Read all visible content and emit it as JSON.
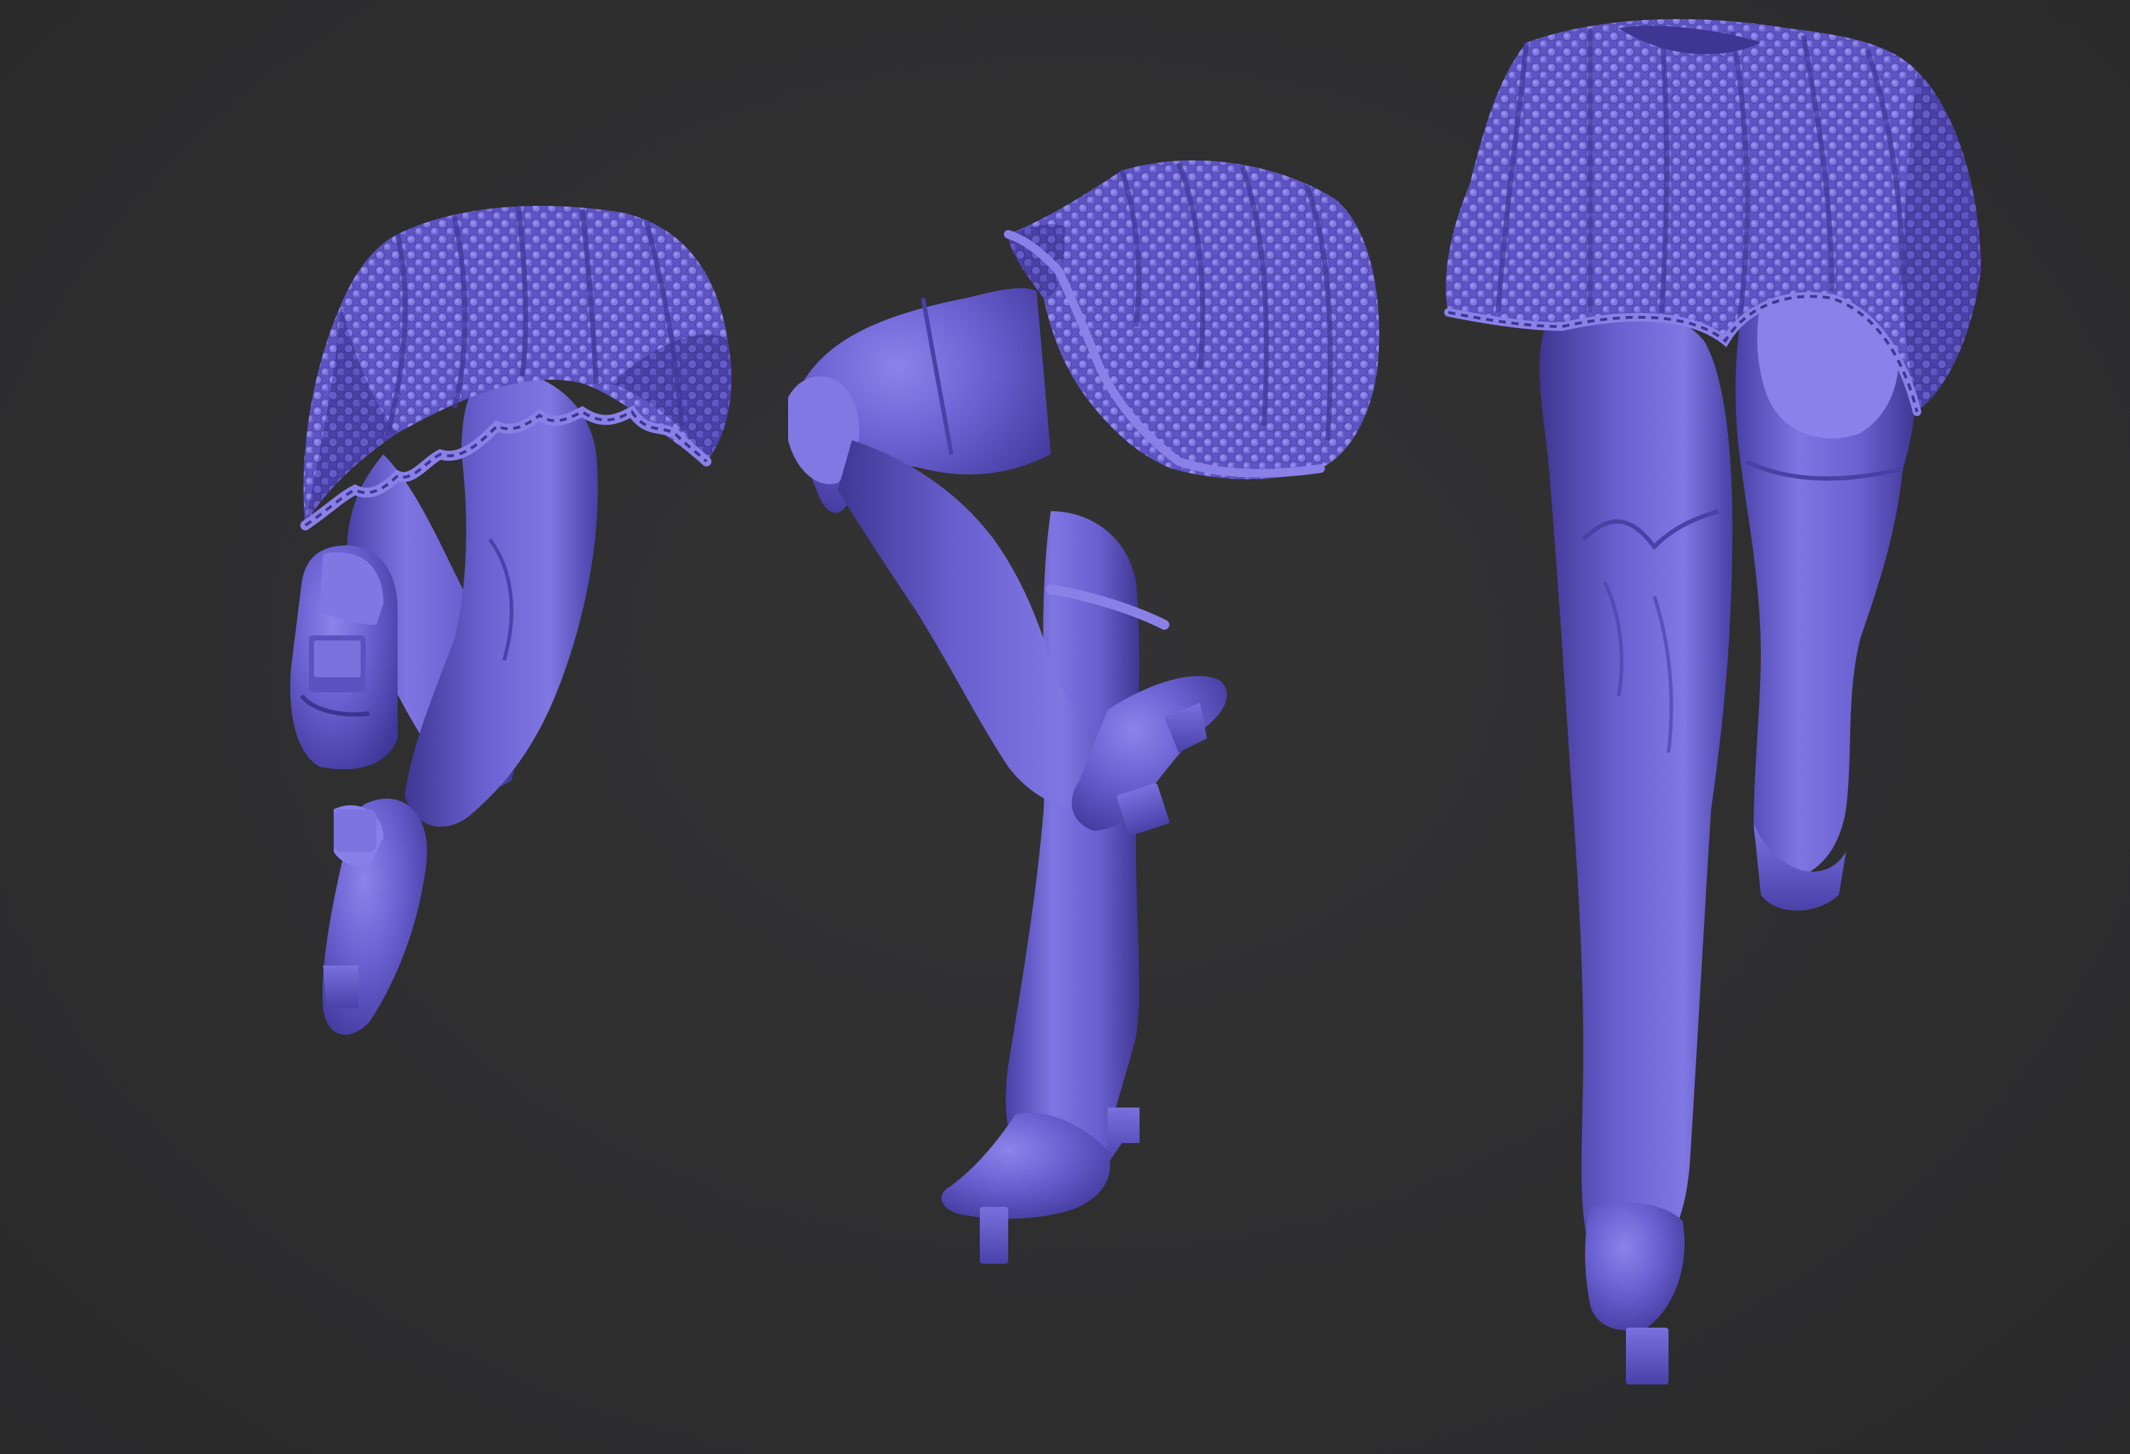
{
  "scene": {
    "background_color": "#2e2e2f",
    "material_color": "#6b5fd1",
    "material_light": "#8b80e8",
    "material_dark": "#3f3694",
    "models": [
      {
        "name": "skirt-and-boots-back-view"
      },
      {
        "name": "skirt-and-boots-side-view"
      },
      {
        "name": "skirt-and-boots-front-view"
      }
    ]
  }
}
